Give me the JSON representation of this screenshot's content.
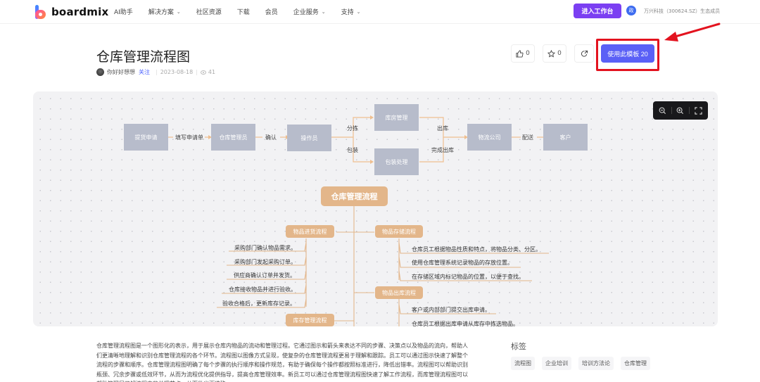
{
  "header": {
    "brand": "boardmix",
    "nav": [
      {
        "label": "AI助手",
        "dropdown": false
      },
      {
        "label": "解决方案",
        "dropdown": true
      },
      {
        "label": "社区资源",
        "dropdown": false
      },
      {
        "label": "下载",
        "dropdown": false
      },
      {
        "label": "会员",
        "dropdown": false
      },
      {
        "label": "企业服务",
        "dropdown": true
      },
      {
        "label": "支持",
        "dropdown": true
      }
    ],
    "workbench_label": "进入工作台",
    "partner_badge": "政",
    "partner_text": "万兴科技（300624.SZ）生态成员"
  },
  "template": {
    "title": "仓库管理流程图",
    "author": "你好好想想",
    "follow_label": "关注",
    "date": "2023-08-18",
    "views": "41",
    "likes": "0",
    "favorites": "0",
    "use_label": "使用此模板 20"
  },
  "flowchart": {
    "nodes": [
      "提货申请",
      "仓库管理员",
      "操作员",
      "库房管理",
      "包装处理",
      "物流公司",
      "客户"
    ],
    "edge_labels": [
      "填写申请单",
      "确认",
      "分拣",
      "包装",
      "出库",
      "完成出库",
      "配送"
    ]
  },
  "mindmap": {
    "root": "仓库管理流程",
    "branches": [
      {
        "label": "物品进货流程",
        "leaves": [
          "采购部门确认物品需求。",
          "采购部门发起采购订单。",
          "供应商确认订单并发货。",
          "仓库接收物品并进行验收。",
          "验收合格后，更新库存记录。"
        ]
      },
      {
        "label": "物品存储流程",
        "leaves": [
          "仓库员工根据物品性质和特点，将物品分类、分区。",
          "使用仓库管理系统记录物品的存放位置。",
          "在存储区域内标记物品的位置，以便于查找。"
        ]
      },
      {
        "label": "物品出库流程",
        "leaves": [
          "客户或内部部门提交出库申请。",
          "仓库员工根据出库申请从库存中拣选物品。"
        ]
      },
      {
        "label": "库存管理流程",
        "leaves": []
      }
    ]
  },
  "description": "仓库管理流程图是一个图形化的表示，用于展示仓库内物品的流动和管理过程。它通过图示和箭头来表达不同的步骤、决策点以及物品的流向，帮助人们更清晰地理解和识别仓库管理流程的各个环节。流程图以图像方式呈现，使复杂的仓库管理流程更易于理解和跟踪。员工可以通过图示快速了解整个流程的步骤和顺序。仓库管理流程图明确了每个步骤的执行顺序和操作规范，有助于确保每个操作都按照标准进行，降低出错率。流程图可以帮助识别瓶颈、冗余步骤或低效环节，从而为流程优化提供指导，提高仓库管理效率。新员工可以通过仓库管理流程图快速了解工作流程，而库管理流程图可以帮助管理层了解流程中的关键节点，从而做出更准确",
  "tags": {
    "title": "标签",
    "items": [
      "流程图",
      "企业培训",
      "培训方法论",
      "仓库管理"
    ]
  },
  "colors": {
    "accent": "#5a60f6",
    "workbench": "#7b3ff2",
    "node": "#b7bccb",
    "mindmap": "#e3b68a",
    "annotation": "#e3131f"
  }
}
